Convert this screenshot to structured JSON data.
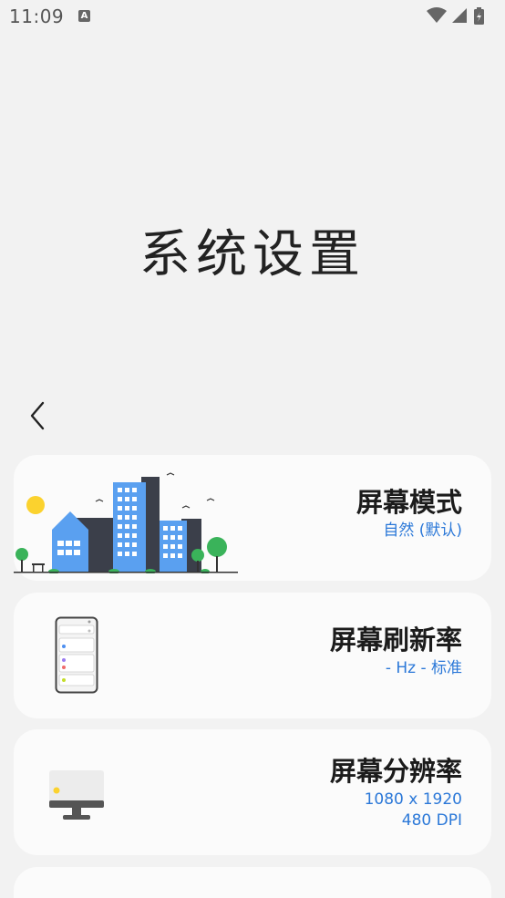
{
  "status_bar": {
    "time": "11:09",
    "notification_letter": "A"
  },
  "page": {
    "title": "系统设置"
  },
  "cards": [
    {
      "title": "屏幕模式",
      "subtitle": "自然 (默认)",
      "illustration": "city-illustration"
    },
    {
      "title": "屏幕刷新率",
      "subtitle": "- Hz - 标准",
      "illustration": "phone-illustration"
    },
    {
      "title": "屏幕分辨率",
      "subtitle_lines": [
        "1080 x 1920",
        "480 DPI"
      ],
      "illustration": "monitor-illustration"
    }
  ],
  "colors": {
    "background": "#f2f2f2",
    "card": "#fbfbfb",
    "accent_blue": "#2b78d8",
    "title_text": "#1c1c1c"
  }
}
